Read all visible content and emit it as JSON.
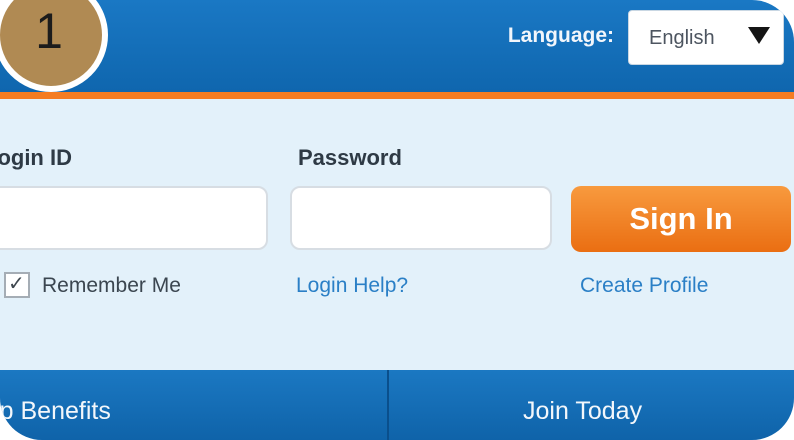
{
  "step_badge": "1",
  "header": {
    "language_label": "Language:",
    "language_value": "English"
  },
  "login": {
    "login_id_label": "Login ID",
    "password_label": "Password",
    "sign_in_label": "Sign In",
    "remember_me_label": "Remember Me",
    "remember_me_checked": true,
    "login_help_label": "Login Help?",
    "create_profile_label": "Create Profile"
  },
  "nav": {
    "membership_benefits_label": "Membership Benefits",
    "join_today_label": "Join Today"
  },
  "colors": {
    "header_blue": "#1a78c4",
    "accent_orange": "#f47c22",
    "link_blue": "#2a7fc6",
    "badge_gold": "#b08a53"
  }
}
